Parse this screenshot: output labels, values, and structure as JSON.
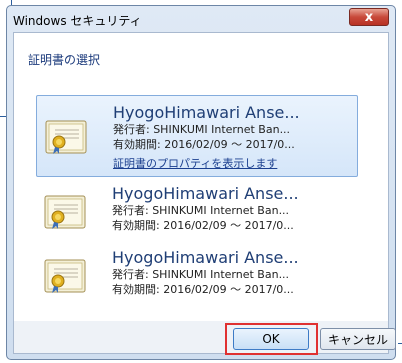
{
  "window": {
    "title": "Windows セキュリティ",
    "close_label": "x"
  },
  "dialog": {
    "heading": "証明書の選択"
  },
  "certificates": [
    {
      "name": "HyogoHimawari Anse...",
      "issuer": "発行者: SHINKUMI Internet Ban...",
      "validity": "有効期間: 2016/02/09 ～ 2017/0...",
      "link": "証明書のプロパティを表示します",
      "selected": true
    },
    {
      "name": "HyogoHimawari Anse...",
      "issuer": "発行者: SHINKUMI Internet Ban...",
      "validity": "有効期間: 2016/02/09 ～ 2017/0...",
      "selected": false
    },
    {
      "name": "HyogoHimawari Anse...",
      "issuer": "発行者: SHINKUMI Internet Ban...",
      "validity": "有効期間: 2016/02/09 ～ 2017/0...",
      "selected": false
    }
  ],
  "buttons": {
    "ok": "OK",
    "cancel": "キャンセル"
  },
  "colors": {
    "highlight_box": "#e03131",
    "selection": "#d5e6f9",
    "close_button": "#c8493a"
  }
}
